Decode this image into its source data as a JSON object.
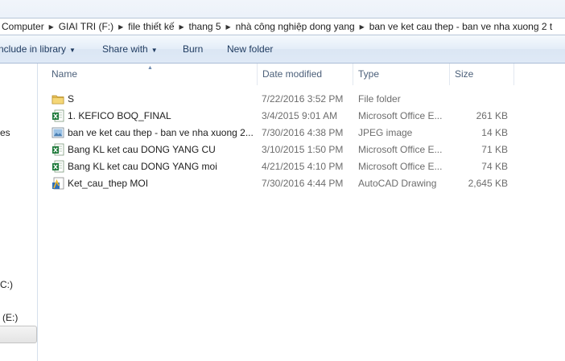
{
  "breadcrumb": {
    "items": [
      "Computer",
      "GIAI TRI (F:)",
      "file thiết kế",
      "thang 5",
      "nhà công nghiệp dong yang",
      "ban ve ket cau thep - ban ve nha xuong 2 t"
    ]
  },
  "toolbar": {
    "include_label": "nclude in library",
    "share_label": "Share with",
    "burn_label": "Burn",
    "new_folder_label": "New folder"
  },
  "nav": {
    "item_1": "es",
    "item_2": "C:)",
    "item_3": "(E:)"
  },
  "columns": {
    "name": "Name",
    "date": "Date modified",
    "type": "Type",
    "size": "Size"
  },
  "files": [
    {
      "name": "S",
      "date": "7/22/2016 3:52 PM",
      "type": "File folder",
      "size": "",
      "icon": "folder-icon"
    },
    {
      "name": "1. KEFICO BOQ_FINAL",
      "date": "3/4/2015 9:01 AM",
      "type": "Microsoft Office E...",
      "size": "261 KB",
      "icon": "excel-file-icon"
    },
    {
      "name": "ban ve ket cau thep - ban ve nha xuong 2...",
      "date": "7/30/2016 4:38 PM",
      "type": "JPEG image",
      "size": "14 KB",
      "icon": "jpeg-file-icon"
    },
    {
      "name": "Bang KL ket cau DONG YANG CU",
      "date": "3/10/2015 1:50 PM",
      "type": "Microsoft Office E...",
      "size": "71 KB",
      "icon": "excel-file-icon"
    },
    {
      "name": "Bang KL ket cau DONG YANG moi",
      "date": "4/21/2015 4:10 PM",
      "type": "Microsoft Office E...",
      "size": "74 KB",
      "icon": "excel-file-icon"
    },
    {
      "name": "Ket_cau_thep MOI",
      "date": "7/30/2016 4:44 PM",
      "type": "AutoCAD Drawing",
      "size": "2,645 KB",
      "icon": "autocad-file-icon"
    }
  ]
}
